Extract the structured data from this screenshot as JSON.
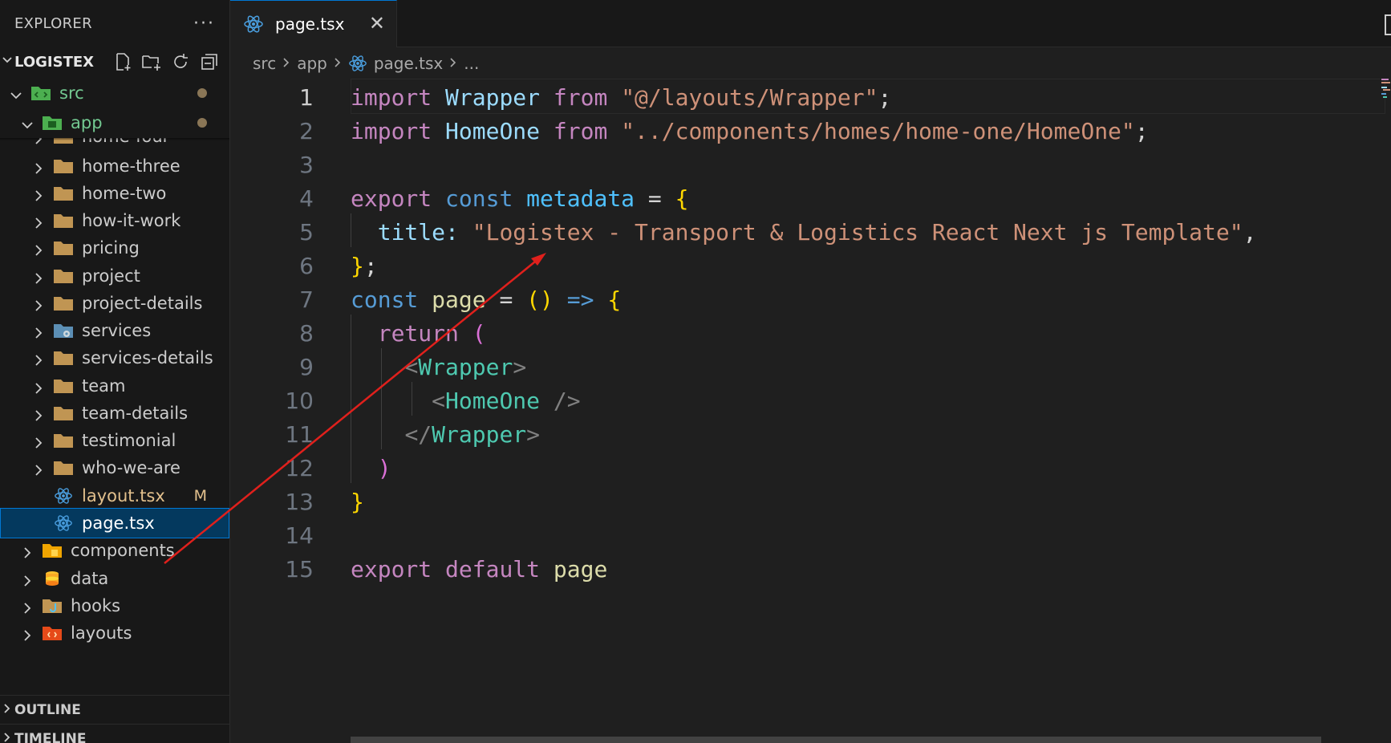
{
  "explorer": {
    "title": "EXPLORER",
    "more": "···",
    "project": "LOGISTEX"
  },
  "tree": [
    {
      "label": "src",
      "depth": 1,
      "expanded": true,
      "icon": "folder-src-icon",
      "status": "dot",
      "tone": "green"
    },
    {
      "label": "app",
      "depth": 2,
      "expanded": true,
      "icon": "folder-app-icon",
      "status": "dot",
      "tone": "green"
    },
    {
      "label": "home-four",
      "depth": 3,
      "expanded": false,
      "icon": "folder-icon"
    },
    {
      "label": "home-three",
      "depth": 3,
      "expanded": false,
      "icon": "folder-icon"
    },
    {
      "label": "home-two",
      "depth": 3,
      "expanded": false,
      "icon": "folder-icon"
    },
    {
      "label": "how-it-work",
      "depth": 3,
      "expanded": false,
      "icon": "folder-icon"
    },
    {
      "label": "pricing",
      "depth": 3,
      "expanded": false,
      "icon": "folder-icon"
    },
    {
      "label": "project",
      "depth": 3,
      "expanded": false,
      "icon": "folder-icon"
    },
    {
      "label": "project-details",
      "depth": 3,
      "expanded": false,
      "icon": "folder-icon"
    },
    {
      "label": "services",
      "depth": 3,
      "expanded": false,
      "icon": "folder-services-icon"
    },
    {
      "label": "services-details",
      "depth": 3,
      "expanded": false,
      "icon": "folder-icon"
    },
    {
      "label": "team",
      "depth": 3,
      "expanded": false,
      "icon": "folder-icon"
    },
    {
      "label": "team-details",
      "depth": 3,
      "expanded": false,
      "icon": "folder-icon"
    },
    {
      "label": "testimonial",
      "depth": 3,
      "expanded": false,
      "icon": "folder-icon"
    },
    {
      "label": "who-we-are",
      "depth": 3,
      "expanded": false,
      "icon": "folder-icon"
    },
    {
      "label": "layout.tsx",
      "depth": 3,
      "file": true,
      "icon": "react-icon",
      "status": "M",
      "tone": "modified"
    },
    {
      "label": "page.tsx",
      "depth": 3,
      "file": true,
      "icon": "react-icon",
      "selected": true
    },
    {
      "label": "components",
      "depth": 2,
      "expanded": false,
      "icon": "folder-components-icon"
    },
    {
      "label": "data",
      "depth": 2,
      "expanded": false,
      "icon": "folder-data-icon"
    },
    {
      "label": "hooks",
      "depth": 2,
      "expanded": false,
      "icon": "folder-hooks-icon"
    },
    {
      "label": "layouts",
      "depth": 2,
      "expanded": false,
      "icon": "folder-layouts-icon"
    }
  ],
  "panels": {
    "outline": "OUTLINE",
    "timeline": "TIMELINE"
  },
  "tab": {
    "label": "page.tsx",
    "close": "✕"
  },
  "breadcrumb": {
    "src": "src",
    "app": "app",
    "file": "page.tsx",
    "more": "..."
  },
  "line_numbers": [
    "1",
    "2",
    "3",
    "4",
    "5",
    "6",
    "7",
    "8",
    "9",
    "10",
    "11",
    "12",
    "13",
    "14",
    "15"
  ],
  "code": {
    "l1": {
      "kw": "import",
      "id": "Wrapper",
      "from": "from",
      "str": "\"@/layouts/Wrapper\"",
      "end": ";"
    },
    "l2": {
      "kw": "import",
      "id": "HomeOne",
      "from": "from",
      "str": "\"../components/homes/home-one/HomeOne\"",
      "end": ";"
    },
    "l4": {
      "kw": "export",
      "kw2": "const",
      "id": "metadata",
      "op": "=",
      "br": "{"
    },
    "l5": {
      "key": "title",
      "colon": ":",
      "str": "\"Logistex - Transport & Logistics React Next js Template\"",
      "end": ","
    },
    "l6": {
      "br": "}",
      "end": ";"
    },
    "l7": {
      "kw": "const",
      "id": "page",
      "op": "=",
      "p": "()",
      "arrow": "=>",
      "br": "{"
    },
    "l8": {
      "kw": "return",
      "p": "("
    },
    "l9": {
      "open": "<",
      "tag": "Wrapper",
      "close": ">"
    },
    "l10": {
      "open": "<",
      "tag": "HomeOne",
      "close": " />"
    },
    "l11": {
      "open": "</",
      "tag": "Wrapper",
      "close": ">"
    },
    "l12": {
      "p": ")"
    },
    "l13": {
      "br": "}"
    },
    "l15": {
      "kw": "export",
      "kw2": "default",
      "id": "page"
    }
  },
  "colors": {
    "accent": "#0078d4",
    "selection": "#04395e",
    "annotation_arrow": "#e0201c"
  }
}
